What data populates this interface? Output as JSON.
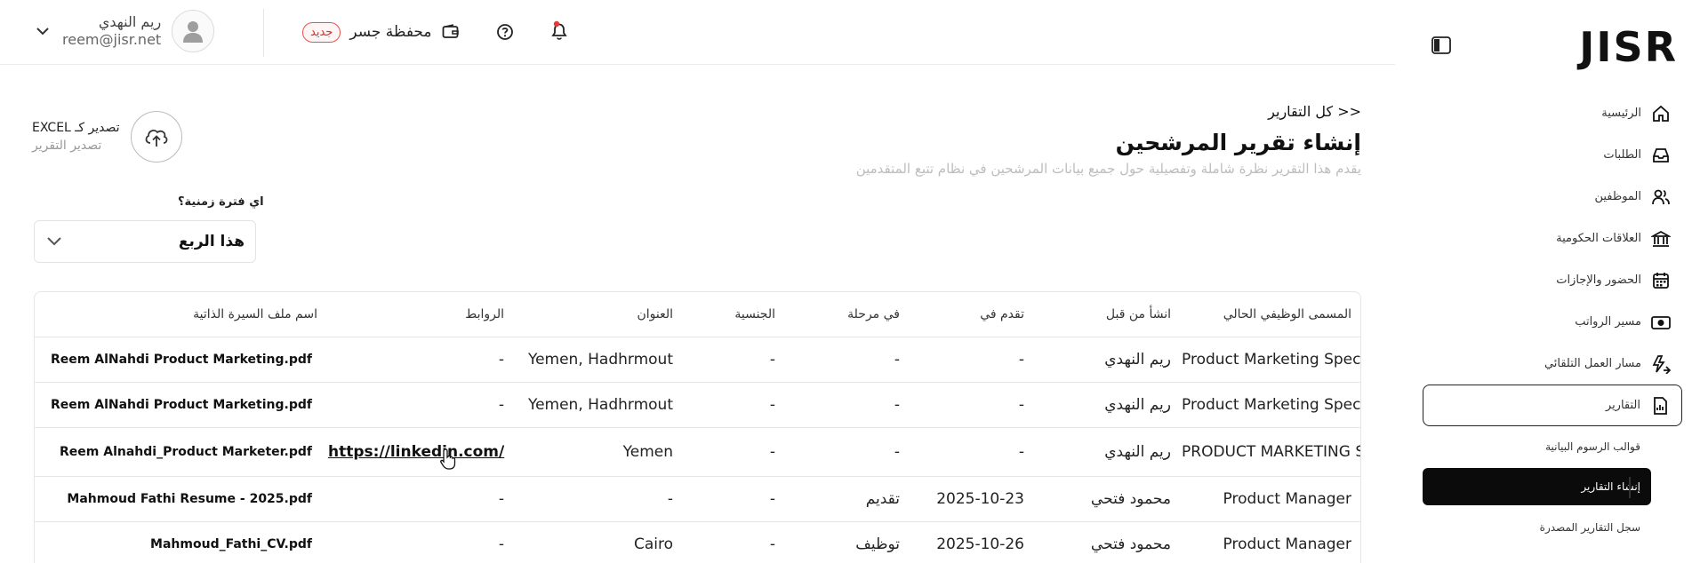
{
  "topbar": {
    "user": {
      "name": "ريم النهدي",
      "email": "reem@jisr.net"
    },
    "wallet": {
      "label": "محفظة جسر",
      "badge": "جديد"
    }
  },
  "sidebar": {
    "logo": "JISR",
    "items": [
      {
        "label": "الرئيسية",
        "icon": "home-icon"
      },
      {
        "label": "الطلبات",
        "icon": "inbox-icon"
      },
      {
        "label": "الموظفين",
        "icon": "users-icon"
      },
      {
        "label": "العلاقات الحكومية",
        "icon": "bank-icon"
      },
      {
        "label": "الحضور والإجازات",
        "icon": "calendar-icon"
      },
      {
        "label": "مسير الرواتب",
        "icon": "money-icon"
      },
      {
        "label": "مسار العمل التلقائي",
        "icon": "automation-icon"
      },
      {
        "label": "التقارير",
        "icon": "report-icon"
      }
    ],
    "subitems": [
      {
        "label": "قوالب الرسوم البيانية"
      },
      {
        "label": "إنشاء التقارير"
      },
      {
        "label": "سجل التقارير المصدرة"
      }
    ]
  },
  "main": {
    "breadcrumb": "<< كل التقارير",
    "title": "إنشاء تقرير المرشحين",
    "description": "يقدم هذا التقرير نظرة شاملة وتفصيلية حول جميع بيانات المرشحين في نظام تتبع المتقدمين",
    "export": {
      "title": "تصدير كـ EXCEL",
      "subtitle": "تصدير التقرير"
    },
    "period": {
      "label": "اي فترة زمنية؟",
      "value": "هذا الربع"
    }
  },
  "table": {
    "headers": {
      "job_title": "المسمى الوظيفي الحالي",
      "created_by": "انشأ من قبل",
      "applied_on": "تقدم في",
      "stage": "في مرحلة",
      "nationality": "الجنسية",
      "address": "العنوان",
      "links": "الروابط",
      "cv": "اسم ملف السيرة الذاتية"
    },
    "rows": [
      {
        "job_title": "Product Marketing Specialist",
        "created_by": "ريم النهدي",
        "applied_on": "-",
        "stage": "-",
        "nationality": "-",
        "address": "Yemen, Hadhrmout",
        "links": "-",
        "cv": "Reem AlNahdi Product Marketing.pdf"
      },
      {
        "job_title": "Product Marketing Specialist",
        "created_by": "ريم النهدي",
        "applied_on": "-",
        "stage": "-",
        "nationality": "-",
        "address": "Yemen, Hadhrmout",
        "links": "-",
        "cv": "Reem AlNahdi Product Marketing.pdf"
      },
      {
        "job_title": "PRODUCT MARKETING SPECILAIST",
        "created_by": "ريم النهدي",
        "applied_on": "-",
        "stage": "-",
        "nationality": "-",
        "address": "Yemen",
        "links": "https://linkedin.com/",
        "cv": "Reem Alnahdi_Product Marketer.pdf"
      },
      {
        "job_title": "Product Manager",
        "created_by": "محمود فتحي",
        "applied_on": "2025-10-23",
        "stage": "تقديم",
        "nationality": "-",
        "address": "-",
        "links": "-",
        "cv": "Mahmoud Fathi Resume - 2025.pdf"
      },
      {
        "job_title": "Product Manager",
        "created_by": "محمود فتحي",
        "applied_on": "2025-10-26",
        "stage": "توظيف",
        "nationality": "-",
        "address": "Cairo",
        "links": "-",
        "cv": "Mahmoud_Fathi_CV.pdf"
      }
    ]
  }
}
